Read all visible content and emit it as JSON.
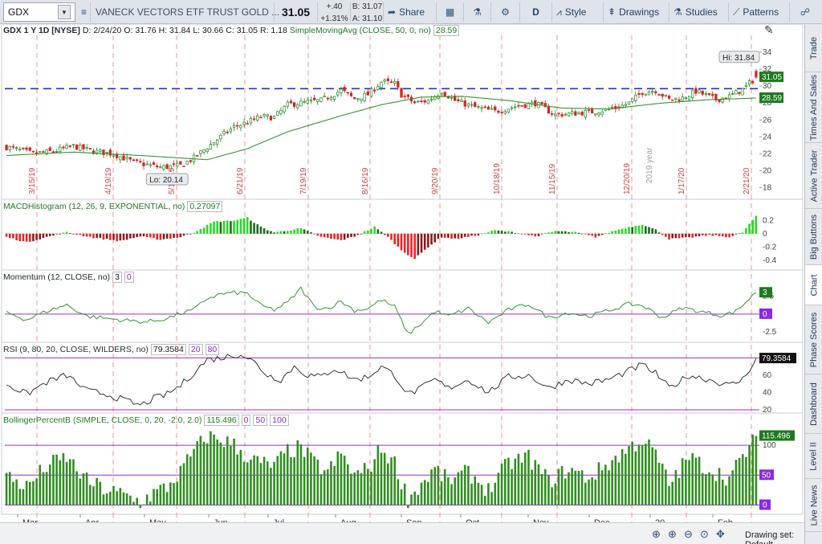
{
  "toolbar": {
    "symbol": "GDX",
    "name": "VANECK VECTORS ETF TRUST GOLD ...",
    "last": "31.05",
    "change": "+.40",
    "change_pct": "+1.31%",
    "bid": "B: 31.07",
    "ask": "A: 31.10",
    "share": "Share",
    "period": "D",
    "style": "Style",
    "drawings": "Drawings",
    "studies": "Studies",
    "patterns": "Patterns"
  },
  "sidebar": {
    "tabs": [
      "Trade",
      "Times And Sales",
      "Active Trader",
      "Big Buttons",
      "Chart",
      "Phase Scores",
      "Dashboard",
      "Level II",
      "Live News"
    ],
    "active": "Chart"
  },
  "footer": {
    "drawing_set": "Drawing set: Default"
  },
  "chart_data": [
    {
      "type": "candlestick",
      "header": {
        "symbol": "GDX 1 Y 1D [NYSE]",
        "date": "D: 2/24/20",
        "open": "O: 31.76",
        "high": "H: 31.84",
        "low": "L: 30.66",
        "close": "C: 31.05",
        "range": "R: 1.18",
        "study": "SimpleMovingAvg (CLOSE, 50, 0, no)",
        "study_value": "28.59"
      },
      "ylim": [
        17,
        36
      ],
      "yticks": [
        "34",
        "32",
        "30",
        "28",
        "26",
        "24",
        "22",
        "20",
        "18"
      ],
      "hi_label": "Hi: 31.84",
      "lo_label": "Lo: 20.14",
      "last_label": "31.05",
      "sma_label": "28.59",
      "reference_line": 29.7,
      "period_markers": [
        "3/15/19",
        "4/19/19",
        "5/17/19",
        "6/21/19",
        "7/19/19",
        "8/16/19",
        "9/20/19",
        "10/18/19",
        "11/15/19",
        "12/20/19",
        "1/17/20",
        "2/21/20"
      ],
      "year_marker": "2019 year",
      "x_months": [
        "Mar",
        "Apr",
        "May",
        "Jun",
        "Jul",
        "Aug",
        "Sep",
        "Oct",
        "Nov",
        "Dec",
        "20",
        "Feb"
      ],
      "close_anchors": [
        [
          0,
          22.8
        ],
        [
          8,
          22.0
        ],
        [
          14,
          22.3
        ],
        [
          20,
          22.9
        ],
        [
          26,
          22.3
        ],
        [
          32,
          22.0
        ],
        [
          38,
          21.0
        ],
        [
          46,
          20.4
        ],
        [
          52,
          20.6
        ],
        [
          56,
          21.5
        ],
        [
          60,
          22.8
        ],
        [
          64,
          24.0
        ],
        [
          68,
          25.2
        ],
        [
          72,
          25.7
        ],
        [
          76,
          26.4
        ],
        [
          80,
          26.3
        ],
        [
          84,
          27.8
        ],
        [
          88,
          28.0
        ],
        [
          94,
          28.3
        ],
        [
          100,
          29.5
        ],
        [
          104,
          28.5
        ],
        [
          108,
          29.0
        ],
        [
          112,
          30.5
        ],
        [
          116,
          30.3
        ],
        [
          118,
          29.0
        ],
        [
          122,
          28.0
        ],
        [
          126,
          28.3
        ],
        [
          130,
          29.4
        ],
        [
          134,
          28.3
        ],
        [
          140,
          27.5
        ],
        [
          146,
          27.0
        ],
        [
          152,
          27.6
        ],
        [
          158,
          28.0
        ],
        [
          164,
          26.6
        ],
        [
          170,
          26.8
        ],
        [
          176,
          27.0
        ],
        [
          182,
          27.4
        ],
        [
          186,
          28.0
        ],
        [
          190,
          29.3
        ],
        [
          194,
          29.5
        ],
        [
          198,
          28.4
        ],
        [
          202,
          28.6
        ],
        [
          206,
          29.4
        ],
        [
          212,
          28.4
        ],
        [
          216,
          28.8
        ],
        [
          220,
          29.6
        ],
        [
          224,
          31.05
        ]
      ],
      "sma_anchors": [
        [
          0,
          21.8
        ],
        [
          20,
          22.2
        ],
        [
          40,
          21.8
        ],
        [
          60,
          21.3
        ],
        [
          72,
          22.6
        ],
        [
          84,
          24.6
        ],
        [
          100,
          26.5
        ],
        [
          112,
          27.8
        ],
        [
          124,
          28.7
        ],
        [
          136,
          28.8
        ],
        [
          150,
          28.3
        ],
        [
          166,
          27.4
        ],
        [
          180,
          27.3
        ],
        [
          196,
          28.0
        ],
        [
          210,
          28.4
        ],
        [
          224,
          28.59
        ]
      ]
    },
    {
      "type": "bar",
      "header": {
        "title": "MACDHistogram (12, 26, 9, EXPONENTIAL, no)",
        "value": "0.27097"
      },
      "ylim": [
        -0.5,
        0.35
      ],
      "yticks": [
        "0.2",
        "0",
        "-0.2",
        "-0.4"
      ],
      "anchors": [
        [
          0,
          -0.05
        ],
        [
          6,
          -0.13
        ],
        [
          12,
          -0.05
        ],
        [
          18,
          0.02
        ],
        [
          26,
          -0.06
        ],
        [
          34,
          -0.11
        ],
        [
          40,
          -0.04
        ],
        [
          46,
          -0.09
        ],
        [
          52,
          -0.05
        ],
        [
          56,
          0.02
        ],
        [
          62,
          0.18
        ],
        [
          68,
          0.2
        ],
        [
          72,
          0.24
        ],
        [
          76,
          0.1
        ],
        [
          80,
          0.02
        ],
        [
          88,
          0.08
        ],
        [
          94,
          -0.05
        ],
        [
          100,
          -0.1
        ],
        [
          104,
          -0.04
        ],
        [
          110,
          0.1
        ],
        [
          114,
          -0.05
        ],
        [
          118,
          -0.25
        ],
        [
          122,
          -0.38
        ],
        [
          126,
          -0.2
        ],
        [
          130,
          -0.05
        ],
        [
          134,
          -0.08
        ],
        [
          140,
          -0.03
        ],
        [
          146,
          0.05
        ],
        [
          152,
          0.02
        ],
        [
          158,
          -0.04
        ],
        [
          164,
          0.04
        ],
        [
          170,
          0.02
        ],
        [
          176,
          -0.05
        ],
        [
          182,
          0.05
        ],
        [
          186,
          0.1
        ],
        [
          190,
          0.14
        ],
        [
          194,
          0.06
        ],
        [
          198,
          -0.08
        ],
        [
          204,
          -0.06
        ],
        [
          210,
          -0.02
        ],
        [
          216,
          -0.05
        ],
        [
          220,
          0.02
        ],
        [
          224,
          0.27097
        ]
      ]
    },
    {
      "type": "line",
      "header": {
        "title": "Momentum (12, CLOSE, no)",
        "value": "3",
        "zero": "0"
      },
      "ylim": [
        -3.5,
        4.6
      ],
      "yticks": [
        "2.5",
        "-2.5"
      ],
      "last_label": "3",
      "zero_label": "0",
      "reference_line": 0,
      "anchors": [
        [
          0,
          0.3
        ],
        [
          6,
          -0.8
        ],
        [
          12,
          0.4
        ],
        [
          18,
          1.3
        ],
        [
          24,
          -0.3
        ],
        [
          30,
          -0.6
        ],
        [
          36,
          -0.9
        ],
        [
          42,
          -1.1
        ],
        [
          48,
          -0.6
        ],
        [
          52,
          0.1
        ],
        [
          56,
          0.6
        ],
        [
          60,
          2.2
        ],
        [
          64,
          2.8
        ],
        [
          68,
          3.0
        ],
        [
          72,
          2.9
        ],
        [
          76,
          1.2
        ],
        [
          80,
          0.6
        ],
        [
          84,
          1.6
        ],
        [
          88,
          3.6
        ],
        [
          92,
          1.0
        ],
        [
          96,
          0.8
        ],
        [
          100,
          1.8
        ],
        [
          104,
          0.5
        ],
        [
          108,
          0.8
        ],
        [
          112,
          2.0
        ],
        [
          116,
          1.0
        ],
        [
          120,
          -2.8
        ],
        [
          124,
          -1.3
        ],
        [
          128,
          0.4
        ],
        [
          132,
          -0.3
        ],
        [
          138,
          0.8
        ],
        [
          144,
          -1.2
        ],
        [
          150,
          0.6
        ],
        [
          156,
          1.4
        ],
        [
          162,
          -0.5
        ],
        [
          168,
          0.2
        ],
        [
          174,
          -0.3
        ],
        [
          180,
          0.5
        ],
        [
          186,
          1.4
        ],
        [
          190,
          1.2
        ],
        [
          196,
          -0.5
        ],
        [
          202,
          0.9
        ],
        [
          208,
          0.3
        ],
        [
          214,
          -0.2
        ],
        [
          218,
          0.4
        ],
        [
          224,
          3.0
        ]
      ]
    },
    {
      "type": "line",
      "header": {
        "title": "RSI (9, 80, 20, CLOSE, WILDERS, no)",
        "value": "79.3584",
        "lower": "20",
        "upper": "80"
      },
      "ylim": [
        20,
        85
      ],
      "yticks": [
        "60",
        "40",
        "20"
      ],
      "last_label": "79.3584",
      "upper_line": 80,
      "lower_line": 20,
      "anchors": [
        [
          0,
          50
        ],
        [
          6,
          38
        ],
        [
          12,
          52
        ],
        [
          18,
          60
        ],
        [
          24,
          42
        ],
        [
          30,
          38
        ],
        [
          36,
          30
        ],
        [
          40,
          25
        ],
        [
          44,
          33
        ],
        [
          48,
          38
        ],
        [
          52,
          48
        ],
        [
          56,
          63
        ],
        [
          60,
          78
        ],
        [
          64,
          80
        ],
        [
          68,
          83
        ],
        [
          70,
          85
        ],
        [
          74,
          75
        ],
        [
          78,
          60
        ],
        [
          82,
          55
        ],
        [
          86,
          70
        ],
        [
          90,
          60
        ],
        [
          94,
          58
        ],
        [
          98,
          68
        ],
        [
          104,
          55
        ],
        [
          108,
          58
        ],
        [
          112,
          70
        ],
        [
          116,
          60
        ],
        [
          120,
          38
        ],
        [
          124,
          45
        ],
        [
          128,
          55
        ],
        [
          132,
          45
        ],
        [
          138,
          55
        ],
        [
          144,
          40
        ],
        [
          150,
          58
        ],
        [
          156,
          60
        ],
        [
          162,
          45
        ],
        [
          168,
          55
        ],
        [
          174,
          50
        ],
        [
          180,
          55
        ],
        [
          186,
          65
        ],
        [
          190,
          72
        ],
        [
          194,
          62
        ],
        [
          198,
          45
        ],
        [
          204,
          60
        ],
        [
          210,
          55
        ],
        [
          216,
          48
        ],
        [
          220,
          55
        ],
        [
          224,
          79.3584
        ]
      ]
    },
    {
      "type": "bar",
      "header": {
        "title": "BollingerPercentB (SIMPLE, CLOSE, 0, 20, -2.0, 2.0)",
        "value": "115.496",
        "zero": "0",
        "mid": "50",
        "upper": "100"
      },
      "ylim": [
        -10,
        135
      ],
      "yticks": [
        "100",
        "50",
        "0"
      ],
      "last_label": "115.496",
      "mid_label": "50",
      "zero_label": "0",
      "reference_lines": [
        0,
        50,
        100
      ],
      "anchors": [
        [
          0,
          50
        ],
        [
          6,
          30
        ],
        [
          12,
          65
        ],
        [
          18,
          80
        ],
        [
          24,
          40
        ],
        [
          30,
          25
        ],
        [
          36,
          15
        ],
        [
          40,
          5
        ],
        [
          44,
          20
        ],
        [
          48,
          30
        ],
        [
          52,
          55
        ],
        [
          56,
          90
        ],
        [
          60,
          115
        ],
        [
          64,
          110
        ],
        [
          68,
          100
        ],
        [
          72,
          80
        ],
        [
          76,
          70
        ],
        [
          80,
          65
        ],
        [
          84,
          90
        ],
        [
          88,
          95
        ],
        [
          92,
          70
        ],
        [
          96,
          55
        ],
        [
          100,
          85
        ],
        [
          104,
          50
        ],
        [
          108,
          60
        ],
        [
          112,
          95
        ],
        [
          116,
          70
        ],
        [
          120,
          10
        ],
        [
          124,
          35
        ],
        [
          128,
          60
        ],
        [
          132,
          40
        ],
        [
          138,
          55
        ],
        [
          144,
          25
        ],
        [
          150,
          70
        ],
        [
          156,
          80
        ],
        [
          162,
          40
        ],
        [
          168,
          60
        ],
        [
          174,
          45
        ],
        [
          180,
          70
        ],
        [
          186,
          95
        ],
        [
          190,
          110
        ],
        [
          194,
          85
        ],
        [
          198,
          35
        ],
        [
          204,
          80
        ],
        [
          210,
          60
        ],
        [
          216,
          45
        ],
        [
          220,
          80
        ],
        [
          224,
          115.496
        ]
      ]
    }
  ]
}
